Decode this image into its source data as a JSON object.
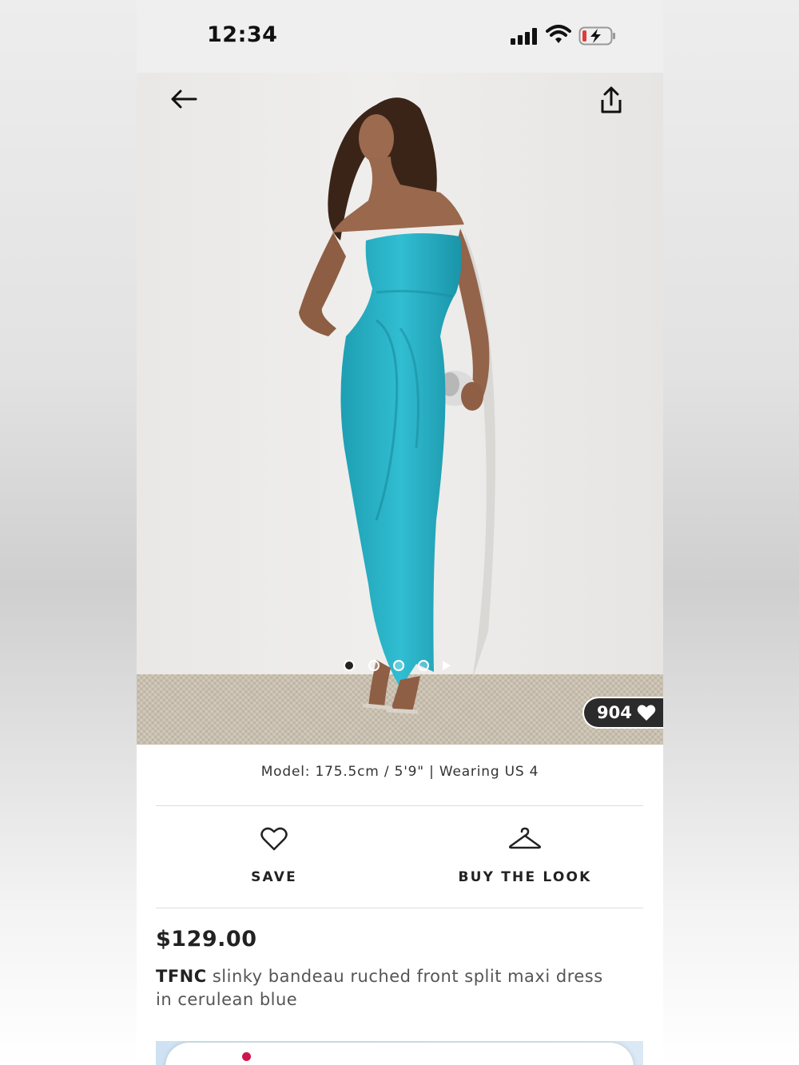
{
  "status_bar": {
    "time": "12:34"
  },
  "gallery": {
    "dot_count": 4,
    "active_index": 0,
    "likes": "904"
  },
  "product": {
    "model_info": "Model: 175.5cm / 5'9\" | Wearing US 4",
    "price": "$129.00",
    "brand": "TFNC",
    "name": " slinky bandeau ruched front split maxi dress in cerulean blue"
  },
  "actions": {
    "save_label": "SAVE",
    "buy_look_label": "BUY THE LOOK"
  },
  "icons": {
    "back": "arrow-left-icon",
    "share": "share-icon",
    "heart": "heart-icon",
    "hanger": "hanger-icon",
    "signal": "cellular-signal-icon",
    "wifi": "wifi-icon",
    "battery": "battery-charging-icon"
  },
  "colors": {
    "dress": "#2bb3c8",
    "likes_badge": "#2b2b2b",
    "battery_low": "#e23b3b"
  }
}
